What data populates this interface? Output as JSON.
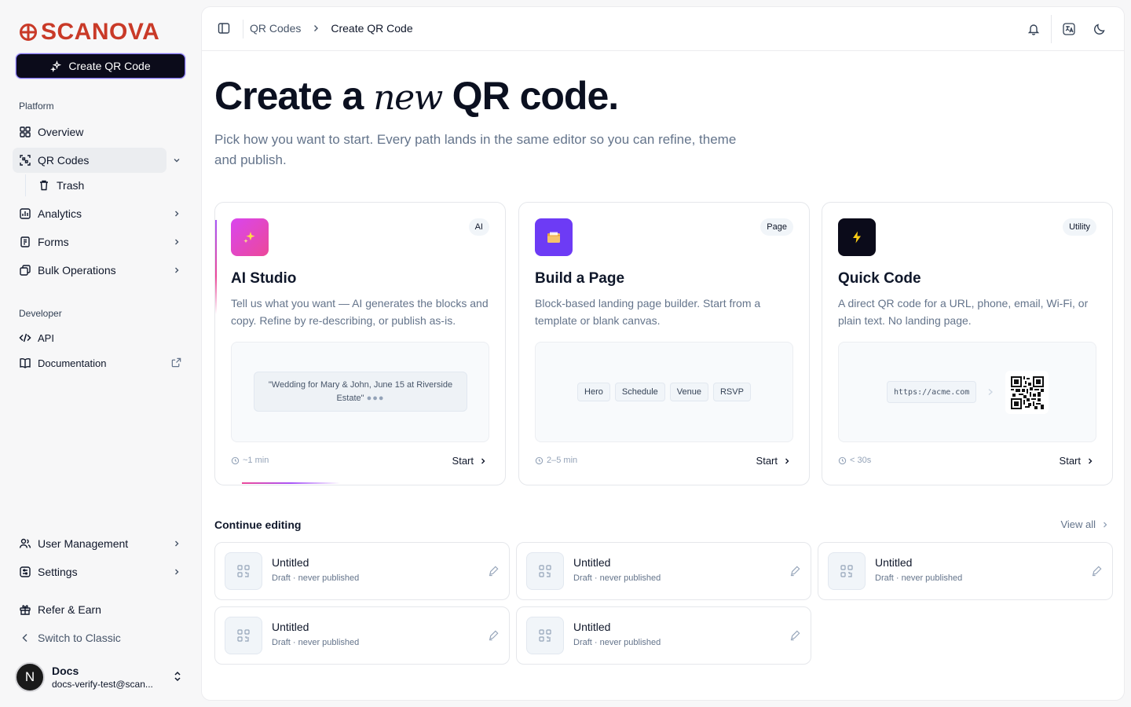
{
  "brand": {
    "name": "SCANOVA",
    "color": "#c93a28"
  },
  "sidebar": {
    "create_button": "Create QR Code",
    "platform_label": "Platform",
    "developer_label": "Developer",
    "items": {
      "overview": "Overview",
      "qr_codes": "QR Codes",
      "trash": "Trash",
      "analytics": "Analytics",
      "forms": "Forms",
      "bulk": "Bulk Operations",
      "api": "API",
      "docs": "Documentation",
      "user_mgmt": "User Management",
      "settings": "Settings",
      "refer": "Refer & Earn",
      "switch": "Switch to Classic"
    },
    "user": {
      "initial": "N",
      "name": "Docs",
      "email": "docs-verify-test@scan..."
    }
  },
  "topbar": {
    "crumb1": "QR Codes",
    "crumb2": "Create QR Code"
  },
  "hero": {
    "title_a": "Create a ",
    "title_em": "new",
    "title_b": " QR code.",
    "subtitle": "Pick how you want to start. Every path lands in the same editor so you can refine, theme and publish."
  },
  "cards": [
    {
      "badge": "AI",
      "title": "AI Studio",
      "icon": "sparkles-icon",
      "description": "Tell us what you want — AI generates the blocks and copy. Refine by re-describing, or publish as-is.",
      "prompt": "\"Wedding for Mary & John, June 15 at Riverside Estate\"",
      "time": "~1 min",
      "start": "Start"
    },
    {
      "badge": "Page",
      "title": "Build a Page",
      "icon": "folder-icon",
      "description": "Block-based landing page builder. Start from a template or blank canvas.",
      "chips": [
        "Hero",
        "Schedule",
        "Venue",
        "RSVP"
      ],
      "time": "2–5 min",
      "start": "Start"
    },
    {
      "badge": "Utility",
      "title": "Quick Code",
      "icon": "lightning-icon",
      "description": "A direct QR code for a URL, phone, email, Wi-Fi, or plain text. No landing page.",
      "url": "https://acme.com",
      "time": "< 30s",
      "start": "Start"
    }
  ],
  "continue": {
    "title": "Continue editing",
    "view_all": "View all",
    "drafts": [
      {
        "title": "Untitled",
        "meta": "Draft · never published"
      },
      {
        "title": "Untitled",
        "meta": "Draft · never published"
      },
      {
        "title": "Untitled",
        "meta": "Draft · never published"
      },
      {
        "title": "Untitled",
        "meta": "Draft · never published"
      },
      {
        "title": "Untitled",
        "meta": "Draft · never published"
      }
    ]
  }
}
